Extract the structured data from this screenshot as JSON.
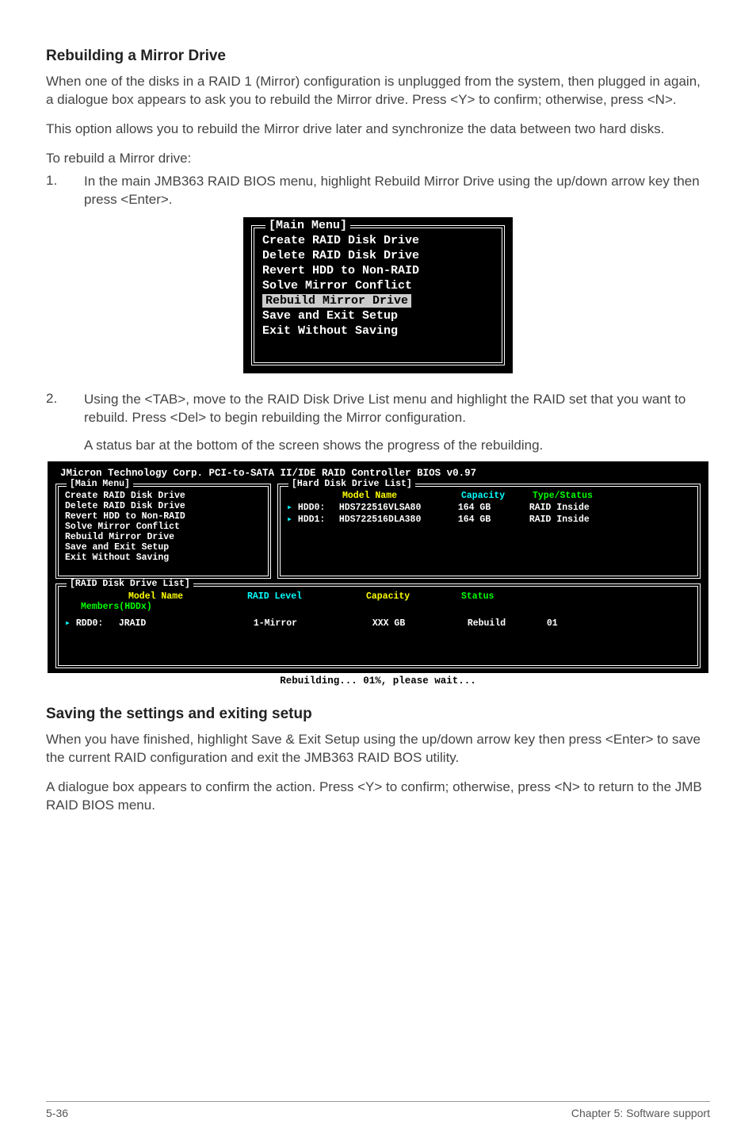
{
  "section1": {
    "heading": "Rebuilding a Mirror Drive",
    "p1": "When one of the disks in a RAID 1 (Mirror) configuration is unplugged from the system, then plugged in again, a dialogue box appears to ask you to rebuild the Mirror drive. Press <Y> to confirm; otherwise, press <N>.",
    "p2": "This option allows you to rebuild the Mirror drive later and synchronize the data between two hard disks.",
    "p3": "To rebuild a Mirror drive:",
    "step1_num": "1.",
    "step1": "In the main JMB363 RAID BIOS menu, highlight Rebuild Mirror Drive using the up/down arrow key then press <Enter>.",
    "menu": {
      "title": "[Main Menu]",
      "items": [
        "Create RAID Disk Drive",
        "Delete RAID Disk Drive",
        "Revert HDD to Non-RAID",
        "Solve Mirror Conflict",
        "Rebuild Mirror Drive",
        "Save and Exit Setup",
        "Exit Without Saving"
      ]
    },
    "step2_num": "2.",
    "step2": "Using the <TAB>, move to the RAID Disk Drive List menu and highlight the RAID set that you want to rebuild. Press <Del> to begin rebuilding the Mirror configuration.",
    "step2b": "A status bar at the bottom of the screen shows the progress of the rebuilding."
  },
  "bios": {
    "header": "JMicron Technology Corp. PCI-to-SATA II/IDE RAID Controller BIOS v0.97",
    "main_title": "[Main Menu]",
    "main_items": [
      "Create RAID Disk Drive",
      "Delete RAID Disk Drive",
      "Revert HDD to Non-RAID",
      "Solve Mirror Conflict",
      "Rebuild Mirror Drive",
      "Save and Exit Setup",
      "Exit Without Saving"
    ],
    "hdd_title": "[Hard Disk Drive List]",
    "hdd_hdr_model": "Model Name",
    "hdd_hdr_cap": "Capacity",
    "hdd_hdr_type": "Type/Status",
    "hdd_rows": [
      {
        "dev": "HDD0:",
        "model": "HDS722516VLSA80",
        "cap": "164 GB",
        "type": "RAID Inside"
      },
      {
        "dev": "HDD1:",
        "model": "HDS722516DLA380",
        "cap": "164 GB",
        "type": "RAID Inside"
      }
    ],
    "raid_title": "[RAID Disk Drive List]",
    "raid_hdr_model": "Model Name",
    "raid_hdr_level": "RAID Level",
    "raid_hdr_cap": "Capacity",
    "raid_hdr_status": "Status",
    "raid_members": "Members(HDDx)",
    "raid_row": {
      "dev": "RDD0:",
      "name": "JRAID",
      "level": "1-Mirror",
      "cap": "XXX GB",
      "status": "Rebuild",
      "members": "01"
    },
    "progress": "Rebuilding... 01%, please wait..."
  },
  "section2": {
    "heading": "Saving the settings and exiting setup",
    "p1": "When you have finished, highlight Save & Exit Setup using the up/down arrow key then press <Enter> to save the current RAID configuration and exit the JMB363 RAID BOS utility.",
    "p2": "A dialogue box appears to confirm the action. Press <Y> to confirm; otherwise, press <N> to return to the JMB RAID BIOS menu."
  },
  "footer": {
    "page": "5-36",
    "chapter": "Chapter 5: Software support"
  }
}
